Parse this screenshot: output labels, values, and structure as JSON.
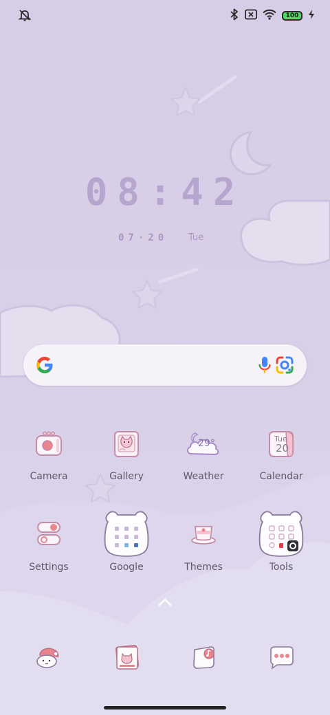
{
  "status_bar": {
    "battery_level": "100",
    "left_icons": [
      "alarm-off-icon"
    ],
    "right_icons": [
      "bluetooth-icon",
      "no-sim-icon",
      "wifi-icon",
      "battery-icon",
      "charging-icon"
    ]
  },
  "clock": {
    "time": "08:42",
    "date": "07·20",
    "day": "Tue"
  },
  "search": {
    "icons": [
      "google-logo-icon",
      "mic-icon",
      "lens-icon"
    ]
  },
  "apps": [
    {
      "label": "Camera"
    },
    {
      "label": "Gallery"
    },
    {
      "label": "Weather",
      "temp": "29°"
    },
    {
      "label": "Calendar",
      "day": "Tue",
      "date": "20"
    },
    {
      "label": "Settings"
    },
    {
      "label": "Google"
    },
    {
      "label": "Themes"
    },
    {
      "label": "Tools"
    }
  ],
  "dock": {
    "icons": [
      "phone-icon",
      "contacts-icon",
      "music-icon",
      "messages-icon"
    ]
  },
  "colors": {
    "accent": "#e9848f",
    "wallpaper": "#d7cfe6",
    "label": "#5f5a6b"
  }
}
